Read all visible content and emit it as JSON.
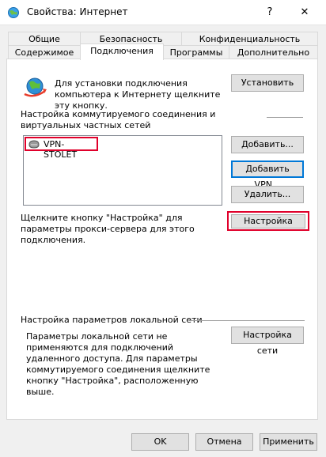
{
  "window": {
    "title": "Свойства: Интернет",
    "help_glyph": "?",
    "close_glyph": "✕"
  },
  "tabs": {
    "row1": [
      "Общие",
      "Безопасность",
      "Конфиденциальность"
    ],
    "row2": [
      "Содержимое",
      "Подключения",
      "Программы",
      "Дополнительно"
    ],
    "active": "Подключения"
  },
  "connections": {
    "setup_text": "Для установки подключения компьютера к Интернету щелкните эту кнопку.",
    "setup_button": "Установить",
    "vpn_group_label": "Настройка коммутируемого соединения и виртуальных частных сетей",
    "list_items": [
      {
        "name": "VPN-STOLET",
        "icon": "network-connection-icon"
      }
    ],
    "add_button": "Добавить...",
    "add_vpn_button": "Добавить VPN...",
    "delete_button": "Удалить...",
    "proxy_text": "Щелкните кнопку \"Настройка\" для параметры прокси-сервера для этого подключения.",
    "settings_button": "Настройка",
    "lan_group_label": "Настройка параметров локальной сети",
    "lan_text": "Параметры локальной сети не применяются для подключений удаленного доступа. Для параметры коммутируемого соединения щелкните кнопку \"Настройка\", расположенную выше.",
    "lan_button": "Настройка сети"
  },
  "footer": {
    "ok": "OK",
    "cancel": "Отмена",
    "apply": "Применить"
  },
  "colors": {
    "highlight_red": "#e0002b",
    "focus_blue": "#0078d7"
  }
}
